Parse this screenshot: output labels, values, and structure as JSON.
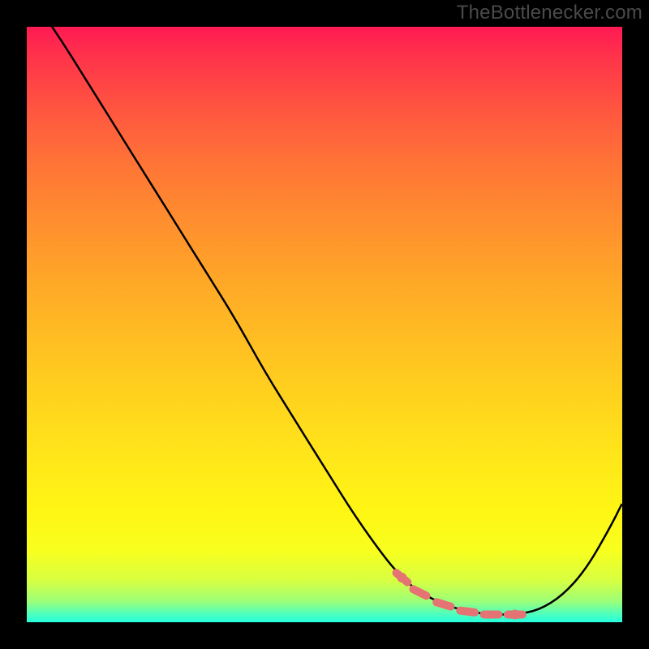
{
  "attribution": "TheBottlenecker.com",
  "colors": {
    "page_bg": "#000000",
    "attribution_text": "#4a4a4a",
    "curve": "#000000",
    "marker": "#e57373",
    "gradient_top": "#ff1a53",
    "gradient_bottom": "#25ffdd"
  },
  "chart_data": {
    "type": "line",
    "title": "",
    "xlabel": "",
    "ylabel": "",
    "xlim": [
      0,
      100
    ],
    "ylim": [
      0,
      100
    ],
    "grid": false,
    "legend": false,
    "series": [
      {
        "name": "bottleneck-curve",
        "x": [
          0,
          5,
          10,
          15,
          20,
          25,
          30,
          35,
          40,
          45,
          50,
          55,
          60,
          63,
          66,
          70,
          74,
          78,
          82,
          86,
          90,
          94,
          98,
          100
        ],
        "values": [
          106,
          99,
          91,
          83,
          75,
          67,
          59,
          51,
          42,
          34,
          26,
          18,
          11,
          7.5,
          5,
          3,
          1.8,
          1.3,
          1.3,
          2,
          4.5,
          9,
          16,
          20
        ]
      }
    ],
    "markers": {
      "name": "optimal-range",
      "style": "dashed-dots",
      "x": [
        63,
        66,
        70,
        74,
        78,
        82
      ],
      "values": [
        7.5,
        5,
        3,
        1.8,
        1.3,
        1.3
      ]
    }
  }
}
